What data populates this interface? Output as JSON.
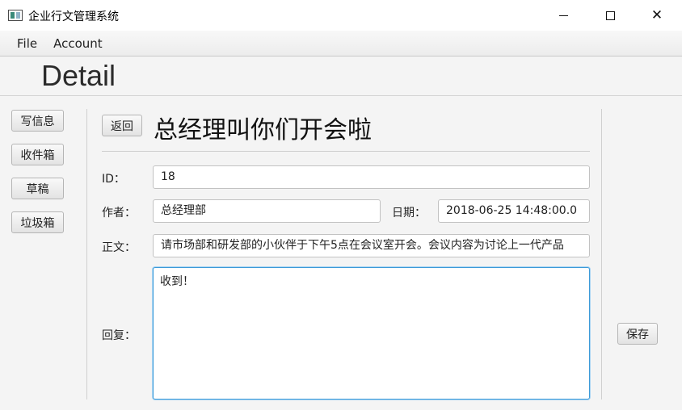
{
  "window": {
    "title": "企业行文管理系统"
  },
  "menu": [
    "File",
    "Account"
  ],
  "page": {
    "title": "Detail"
  },
  "sidebar": [
    {
      "label": "写信息"
    },
    {
      "label": "收件箱"
    },
    {
      "label": "草稿"
    },
    {
      "label": "垃圾箱"
    }
  ],
  "detail": {
    "back_label": "返回",
    "subject": "总经理叫你们开会啦",
    "id_label": "ID：",
    "id_value": "18",
    "author_label": "作者：",
    "author_value": "总经理部",
    "date_label": "日期：",
    "date_value": "2018-06-25 14:48:00.0",
    "body_label": "正文：",
    "body_value": "请市场部和研发部的小伙伴于下午5点在会议室开会。会议内容为讨论上一代产品",
    "reply_label": "回复：",
    "reply_value": "收到！",
    "save_label": "保存"
  },
  "colors": {
    "focus_border": "#3c9ad8",
    "background": "#f4f4f4"
  }
}
